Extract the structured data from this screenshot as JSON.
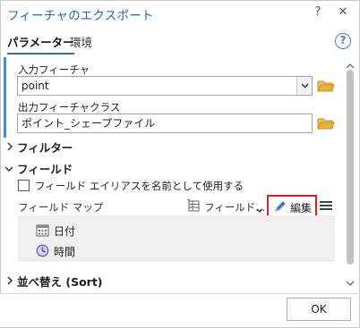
{
  "window": {
    "title": "フィーチャのエクスポート",
    "help_glyph": "?",
    "close_glyph": "✕"
  },
  "tabs": [
    {
      "label": "パラメーター",
      "active": true
    },
    {
      "label": "環境",
      "active": false
    }
  ],
  "help_button": {
    "glyph": "?"
  },
  "parameters": {
    "input_features": {
      "label": "入力フィーチャ",
      "value": "point"
    },
    "output_feature_class": {
      "label": "出力フィーチャクラス",
      "value": "ポイント_シェープファイル"
    }
  },
  "filter_section": {
    "label": "フィルター",
    "expanded": false
  },
  "fields_section": {
    "label": "フィールド",
    "expanded": true,
    "alias_checkbox": {
      "label": "フィールド エイリアスを名前として使用する",
      "checked": false
    },
    "field_map_label": "フィールド マップ",
    "fields_dropdown_label": "フィールド...",
    "edit_button_label": "編集",
    "items": [
      {
        "label": "日付",
        "icon": "calendar-icon"
      },
      {
        "label": "時間",
        "icon": "clock-icon"
      }
    ]
  },
  "sort_section": {
    "label": "並べ替え (Sort)",
    "expanded": false
  },
  "footer": {
    "ok_label": "OK"
  },
  "colors": {
    "title": "#2266bb",
    "accent": "#3a8de0",
    "highlight_border": "#e01c1c",
    "folder": "#e8b13a"
  }
}
